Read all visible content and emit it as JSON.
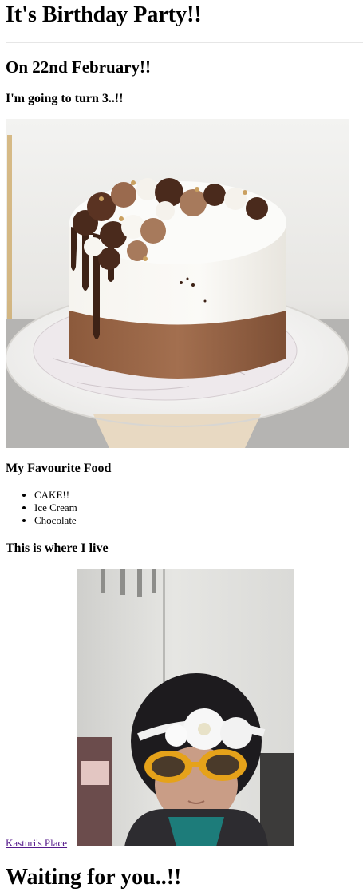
{
  "header": {
    "title": "It's Birthday Party!!",
    "date_heading": "On 22nd February!!",
    "subheading": "I'm going to turn 3..!!"
  },
  "food": {
    "heading": "My Favourite Food",
    "items": [
      "CAKE!!",
      "Ice Cream",
      "Chocolate"
    ]
  },
  "location": {
    "heading": "This is where I live",
    "link_text": "Kasturi's Place"
  },
  "footer": {
    "heading": "Waiting for you..!!"
  },
  "colors": {
    "visited_link": "#551a8b",
    "rule": "#9a9a9a"
  }
}
